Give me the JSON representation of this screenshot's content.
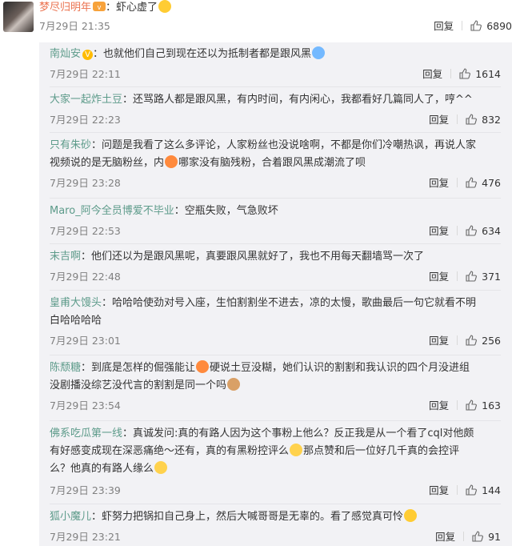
{
  "main_comment": {
    "username": "梦尽归明年",
    "text": "：虾心虚了",
    "time": "7月29日 21:35",
    "reply_label": "回复",
    "likes": "6890"
  },
  "replies": [
    {
      "username": "南灿安",
      "text": "：也就他们自己到现在还以为抵制者都是跟风黑",
      "time": "7月29日 22:11",
      "reply_label": "回复",
      "likes": "1614"
    },
    {
      "username": "大家一起炸土豆",
      "text": "：还骂路人都是跟风黑，有内时间，有内闲心，我都看好几篇同人了，哼^^",
      "time": "7月29日 22:23",
      "reply_label": "回复",
      "likes": "832"
    },
    {
      "username": "只有朱砂",
      "text_a": "：问题是我看了这么多评论，人家粉丝也没说啥啊，不都是你们冷嘲热讽，再说人家",
      "text_b": "视频说的是无脑粉丝，内",
      "text_c": "哪家没有脑残粉，合着跟风黑成潮流了呗",
      "time": "7月29日 23:28",
      "reply_label": "回复",
      "likes": "476"
    },
    {
      "username": "Maro_阿今全员博爱不毕业",
      "text": "：空瓶失败，气急败坏",
      "time": "7月29日 22:53",
      "reply_label": "回复",
      "likes": "634"
    },
    {
      "username": "末吉啊",
      "text": "：他们还以为是跟风黑呢，真要跟风黑就好了，我也不用每天翻墙骂一次了",
      "time": "7月29日 22:48",
      "reply_label": "回复",
      "likes": "371"
    },
    {
      "username": "皇甫大馒头",
      "text_a": "：哈哈哈使劲对号入座，生怕割割坐不进去，凉的太慢，歌曲最后一句它就看不明",
      "text_b": "白哈哈哈哈",
      "time": "7月29日 23:01",
      "reply_label": "回复",
      "likes": "256"
    },
    {
      "username": "陈颓糖",
      "text_a": "：到底是怎样的倔强能让",
      "text_b": "硬说土豆没糊，她们认识的割割和我认识的四个月没进组",
      "text_c": "没剧播没综艺没代言的割割是同一个吗",
      "time": "7月29日 23:54",
      "reply_label": "回复",
      "likes": "163"
    },
    {
      "username": "佛系吃瓜第一线",
      "text_a": "：真诚发问:真的有路人因为这个事粉上他么？反正我是从一个看了cql对他颇",
      "text_b": "有好感变成现在深恶痛绝～还有，真的有黑粉控评么",
      "text_c": "那点赞和后一位好几千真的会控评",
      "text_d": "么？他真的有路人缘么",
      "time": "7月29日 23:39",
      "reply_label": "回复",
      "likes": "144"
    },
    {
      "username": "狐小魔儿",
      "text": "：虾努力把锅扣自己身上，然后大喊哥哥是无辜的。看了感觉真可怜",
      "time": "7月29日 23:21",
      "reply_label": "回复",
      "likes": "91"
    }
  ],
  "colors": {
    "username": "#eb7350",
    "reply_username": "#5d9b8a",
    "time": "#808080",
    "panel": "#f2f2f5"
  }
}
